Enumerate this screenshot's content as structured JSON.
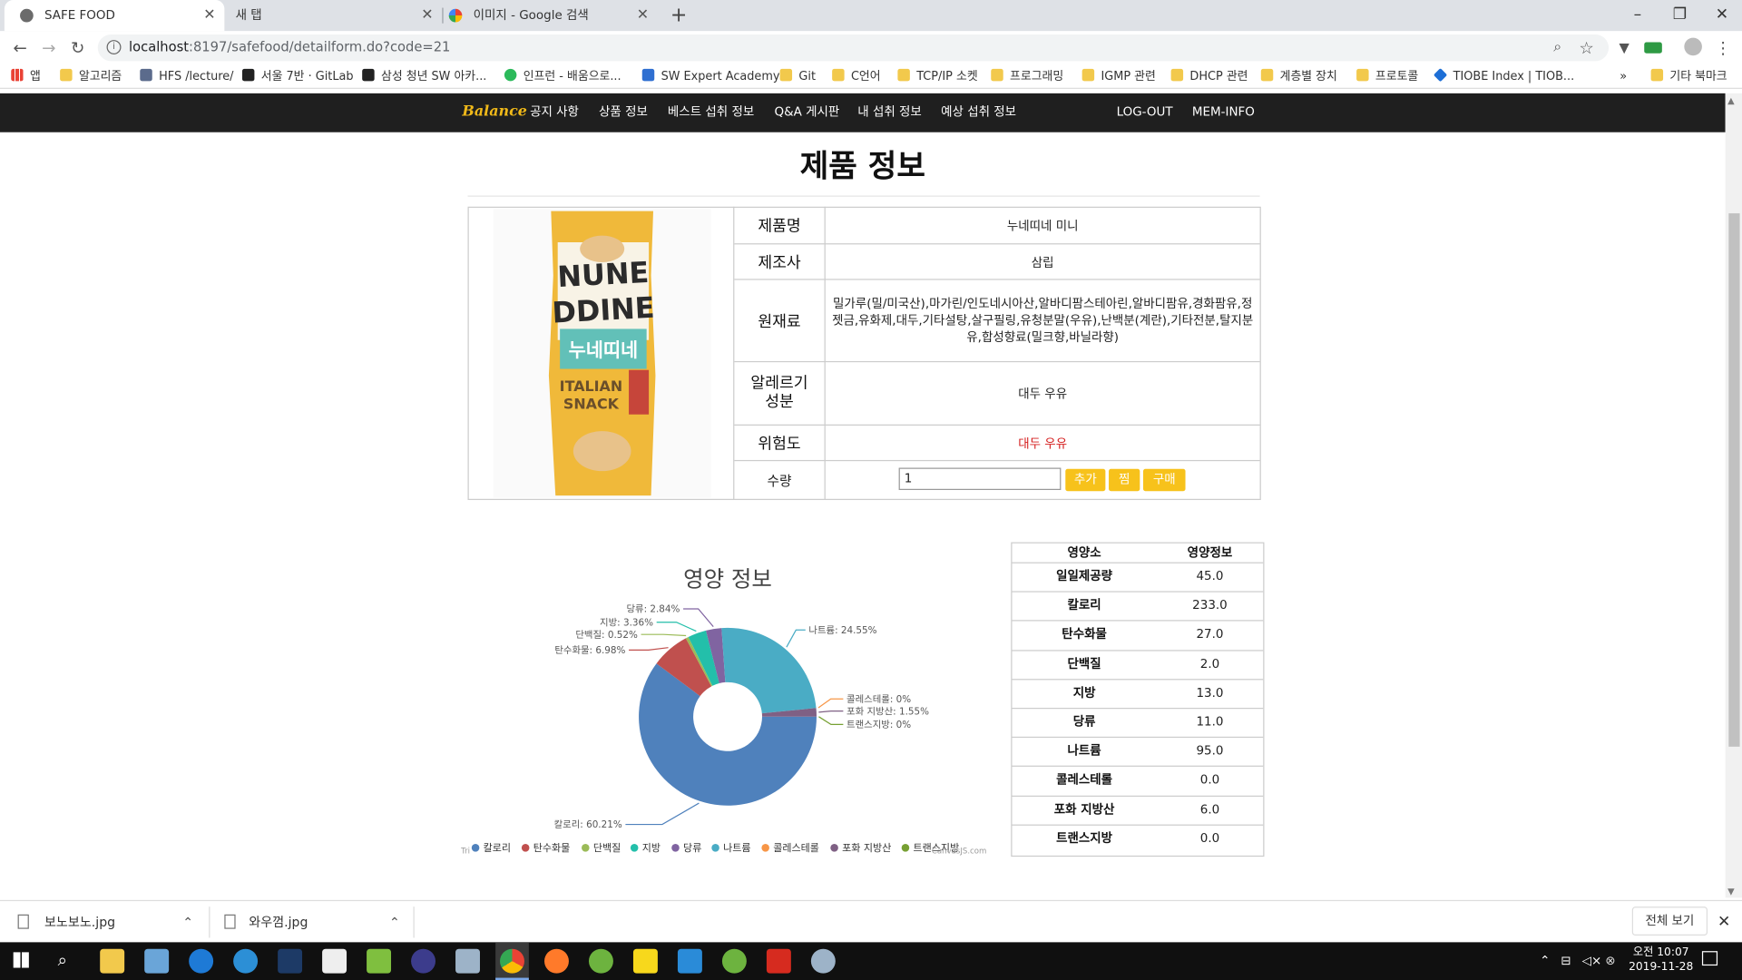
{
  "browser": {
    "tabs": [
      {
        "label": "SAFE FOOD",
        "active": true,
        "icon": "world-icon"
      },
      {
        "label": "새 탭",
        "active": false,
        "icon": "blank-tab-icon"
      },
      {
        "label": "이미지 - Google 검색",
        "active": false,
        "icon": "google-icon"
      }
    ],
    "url_host": "localhost",
    "url_rest": ":8197/safefood/detailform.do?code=21",
    "bookmarks": [
      "앱",
      "알고리즘",
      "HFS /lecture/",
      "서울 7반 · GitLab",
      "삼성 청년 SW 아카...",
      "인프런 - 배움으로...",
      "SW Expert Academy",
      "Git",
      "C언어",
      "TCP/IP 소켓",
      "프로그래밍",
      "IGMP 관련",
      "DHCP 관련",
      "계층별 장치",
      "프로토콜",
      "TIOBE Index | TIOB...",
      "기타 북마크"
    ],
    "bookmark_overflow": "»"
  },
  "site": {
    "brand": "Balance",
    "menu": [
      "공지 사항",
      "상품 정보",
      "베스트 섭취 정보",
      "Q&A 게시판",
      "내 섭취 정보",
      "예상 섭취 정보"
    ],
    "right_menu": [
      "LOG-OUT",
      "MEM-INFO"
    ]
  },
  "page": {
    "title": "제품 정보",
    "product": {
      "name_label": "제품명",
      "name": "누네띠네 미니",
      "maker_label": "제조사",
      "maker": "삼립",
      "material_label": "원재료",
      "material": "밀가루(밀/미국산),마가린/인도네시아산,알바디팜스테아린,알바디팜유,경화팜유,정젯금,유화제,대두,기타설탕,살구필링,유청분말(우유),난백분(계란),기타전분,탈지분유,합성향료(밀크향,바닐라향)",
      "allergy_label": "알레르기 성분",
      "allergy": "대두 우유",
      "danger_label": "위험도",
      "danger": "대두 우유",
      "qty_label": "수량",
      "qty": "1",
      "btn_add": "추가",
      "btn_like": "찜",
      "btn_buy": "구매",
      "package_text": [
        "NUNE",
        "DDINE",
        "누네띠네",
        "ITALIAN",
        "SNACK"
      ]
    },
    "nutrition_header": [
      "영양소",
      "영양정보"
    ],
    "nutrition": [
      {
        "name": "일일제공량",
        "value": "45.0"
      },
      {
        "name": "칼로리",
        "value": "233.0"
      },
      {
        "name": "탄수화물",
        "value": "27.0"
      },
      {
        "name": "단백질",
        "value": "2.0"
      },
      {
        "name": "지방",
        "value": "13.0"
      },
      {
        "name": "당류",
        "value": "11.0"
      },
      {
        "name": "나트륨",
        "value": "95.0"
      },
      {
        "name": "콜레스테롤",
        "value": "0.0"
      },
      {
        "name": "포화 지방산",
        "value": "6.0"
      },
      {
        "name": "트랜스지방",
        "value": "0.0"
      }
    ]
  },
  "chart_data": {
    "type": "pie",
    "title": "영양 정보",
    "donut": true,
    "legend_position": "bottom",
    "slices": [
      {
        "name": "칼로리",
        "value": 60.21,
        "label": "칼로리: 60.21%",
        "color": "#4f81bc"
      },
      {
        "name": "탄수화물",
        "value": 6.98,
        "label": "탄수화물: 6.98%",
        "color": "#c0504e"
      },
      {
        "name": "단백질",
        "value": 0.52,
        "label": "단백질: 0.52%",
        "color": "#9bbb58"
      },
      {
        "name": "지방",
        "value": 3.36,
        "label": "지방: 3.36%",
        "color": "#23bfaa"
      },
      {
        "name": "당류",
        "value": 2.84,
        "label": "당류: 2.84%",
        "color": "#8064a1"
      },
      {
        "name": "나트륨",
        "value": 24.55,
        "label": "나트륨: 24.55%",
        "color": "#4aacc5"
      },
      {
        "name": "콜레스테롤",
        "value": 0,
        "label": "콜레스테롤: 0%",
        "color": "#f79647"
      },
      {
        "name": "포화 지방산",
        "value": 1.55,
        "label": "포화 지방산: 1.55%",
        "color": "#7f6084"
      },
      {
        "name": "트랜스지방",
        "value": 0,
        "label": "트랜스지방: 0%",
        "color": "#77a033"
      }
    ],
    "watermark_left": "Tri",
    "watermark_right": "CanvasJS.com"
  },
  "downloads": {
    "files": [
      "보노보노.jpg",
      "와우껌.jpg"
    ],
    "show_all": "전체 보기"
  },
  "taskbar": {
    "time": "오전 10:07",
    "date": "2019-11-28"
  }
}
